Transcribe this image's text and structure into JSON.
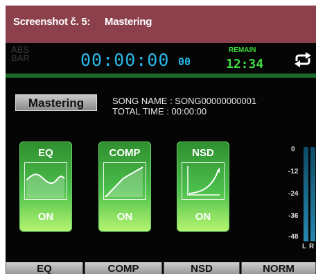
{
  "caption": {
    "label": "Screenshot č. 5:",
    "title": "Mastering",
    "color": "#8b404b"
  },
  "counter": {
    "abs": "ABS",
    "bar": "BAR",
    "time": "00:00:00",
    "frames": "00",
    "remain_label": "REMAIN",
    "remain_value": "12:34",
    "icon": "loop-icon"
  },
  "mastering": {
    "title": "Mastering",
    "song_name": "SONG NAME : SONG00000000001",
    "total_time": "TOTAL TIME : 00:00:00"
  },
  "effects": [
    {
      "name": "EQ",
      "state": "ON",
      "graph": "eq-curve-icon"
    },
    {
      "name": "COMP",
      "state": "ON",
      "graph": "comp-curve-icon"
    },
    {
      "name": "NSD",
      "state": "ON",
      "graph": "nsd-curve-icon"
    }
  ],
  "meter": {
    "scale": [
      "0",
      "-12",
      "-24",
      "-36",
      "-48"
    ],
    "channels": [
      "L",
      "R"
    ]
  },
  "bottom_buttons": [
    "EQ",
    "COMP",
    "NSD",
    "NORM"
  ],
  "colors": {
    "time": "#29b8e8",
    "remain": "#3ddc3d",
    "tile": "#4cc04c"
  }
}
